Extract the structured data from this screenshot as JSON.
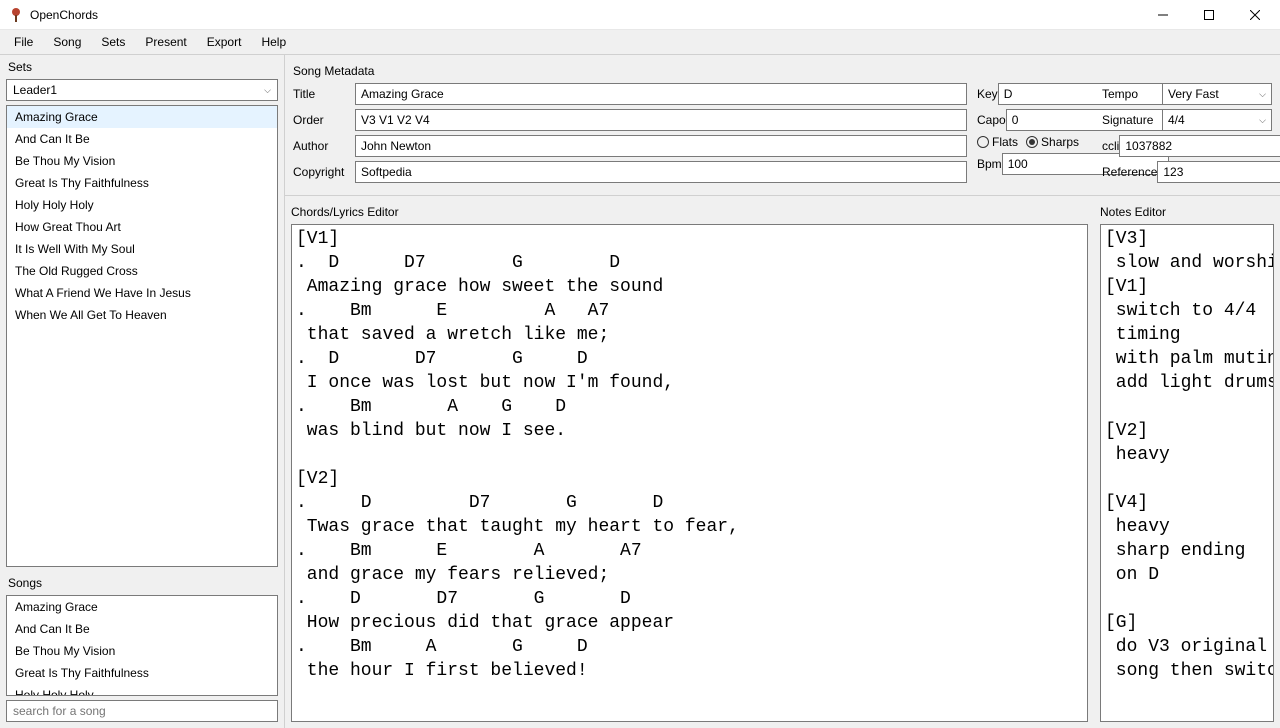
{
  "app": {
    "title": "OpenChords"
  },
  "menu": [
    "File",
    "Song",
    "Sets",
    "Present",
    "Export",
    "Help"
  ],
  "sets": {
    "label": "Sets",
    "selected": "Leader1",
    "items": [
      "Amazing Grace",
      "And Can It Be",
      "Be Thou My Vision",
      "Great Is Thy Faithfulness",
      "Holy Holy Holy",
      "How Great Thou Art",
      "It Is Well With My Soul",
      "The Old Rugged Cross",
      "What A Friend We Have In Jesus",
      "When We All Get To Heaven"
    ]
  },
  "songs": {
    "label": "Songs",
    "items": [
      "Amazing Grace",
      "And Can It Be",
      "Be Thou My Vision",
      "Great Is Thy Faithfulness",
      "Holy Holy Holy"
    ],
    "search_placeholder": "search for a song"
  },
  "metadata": {
    "header": "Song Metadata",
    "labels": {
      "title": "Title",
      "order": "Order",
      "author": "Author",
      "copyright": "Copyright",
      "key": "Key",
      "capo": "Capo",
      "bpm": "Bpm",
      "tempo": "Tempo",
      "signature": "Signature",
      "ccli": "ccli",
      "reference": "Reference",
      "flats": "Flats",
      "sharps": "Sharps"
    },
    "values": {
      "title": "Amazing Grace",
      "order": "V3 V1 V2 V4",
      "author": "John Newton",
      "copyright": "Softpedia",
      "key": "D",
      "capo": "0",
      "bpm": "100",
      "tempo": "Very Fast",
      "signature": "4/4",
      "ccli": "1037882",
      "reference": "123",
      "accidental": "sharps"
    }
  },
  "chords_editor": {
    "label": "Chords/Lyrics Editor",
    "content": "[V1]\n.  D      D7        G        D\n Amazing grace how sweet the sound\n.    Bm      E         A   A7\n that saved a wretch like me;\n.  D       D7       G     D\n I once was lost but now I'm found,\n.    Bm       A    G    D\n was blind but now I see.\n\n[V2]\n.     D         D7       G       D\n Twas grace that taught my heart to fear,\n.    Bm      E        A       A7\n and grace my fears relieved;\n.    D       D7       G       D\n How precious did that grace appear\n.    Bm     A       G     D\n the hour I first believed!"
  },
  "notes_editor": {
    "label": "Notes Editor",
    "content": "[V3]\n slow and worshipful\n[V1]\n switch to 4/4\n timing\n with palm muting\n add light drums\n\n[V2]\n heavy\n\n[V4]\n heavy\n sharp ending\n on D\n\n[G]\n do V3 original\n song then switch"
  }
}
